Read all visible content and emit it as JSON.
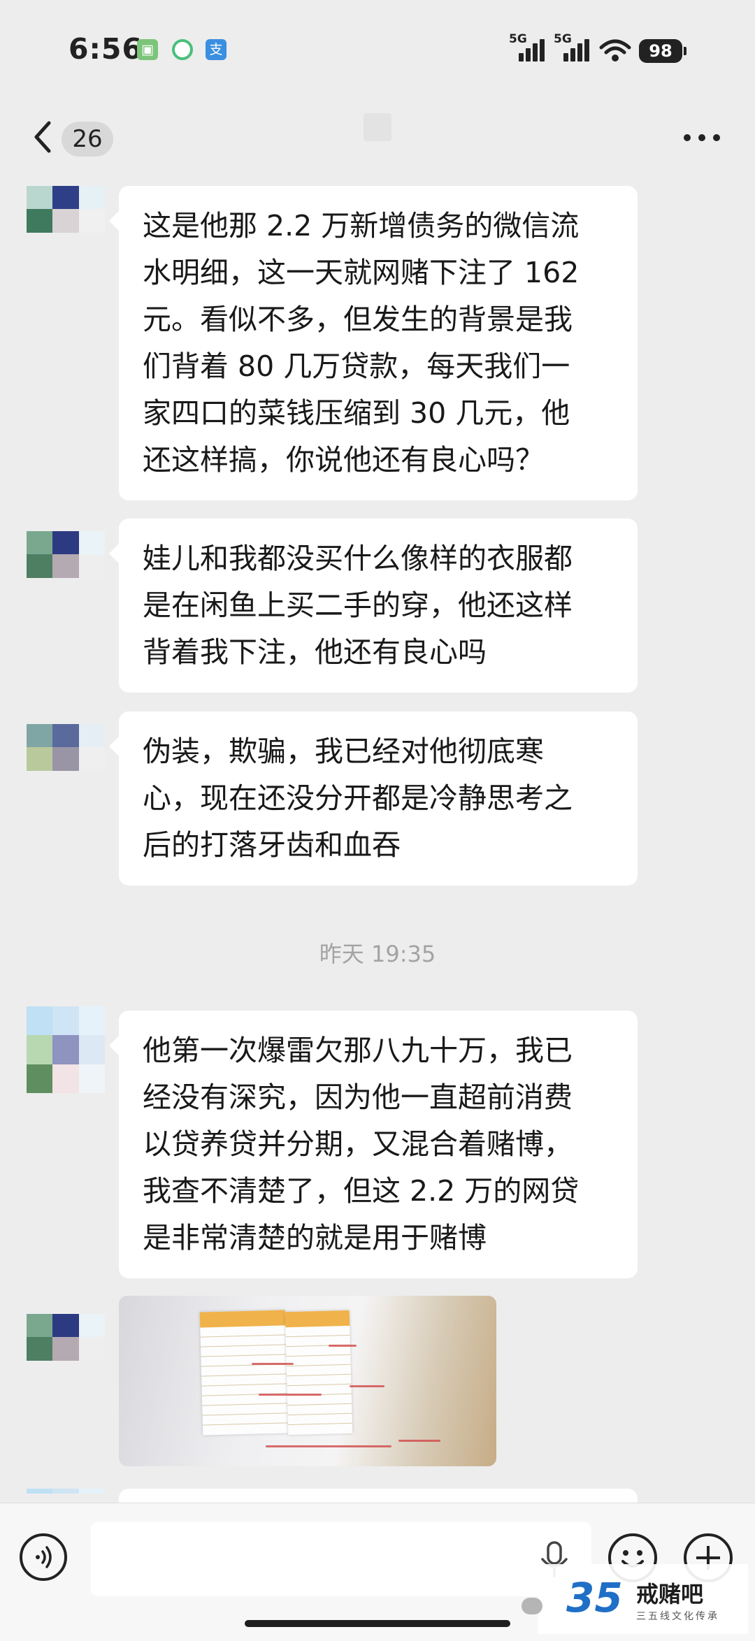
{
  "status_bar": {
    "time": "6:56",
    "signal1_label": "5G",
    "signal2_label": "5G",
    "battery": "98"
  },
  "header": {
    "unread_count": "26"
  },
  "messages": [
    {
      "type": "text",
      "text": "这是他那 2.2 万新增债务的微信流\n水明细，这一天就网赌下注了 162\n元。看似不多，但发生的背景是我\n们背着 80 几万贷款，每天我们一\n家四口的菜钱压缩到 30 几元，他\n还这样搞，你说他还有良心吗？"
    },
    {
      "type": "text",
      "text": "娃儿和我都没买什么像样的衣服都\n是在闲鱼上买二手的穿，他还这样\n背着我下注，他还有良心吗"
    },
    {
      "type": "text",
      "text": "伪装，欺骗，我已经对他彻底寒\n心，现在还没分开都是冷静思考之\n后的打落牙齿和血吞"
    },
    {
      "type": "timestamp",
      "text": "昨天 19:35"
    },
    {
      "type": "text",
      "text": "他第一次爆雷欠那八九十万，我已\n经没有深究，因为他一直超前消费\n以贷养贷并分期，又混合着赌博，\n我查不清楚了，但这 2.2 万的网贷\n是非常清楚的就是用于赌博"
    },
    {
      "type": "image",
      "description": "photo of handwritten debt tables"
    }
  ],
  "input": {
    "placeholder": ""
  },
  "watermark": {
    "number": "35",
    "name": "戒赌吧",
    "sub": "三五线文化传承"
  },
  "colors": {
    "background": "#ededed",
    "bubble": "#ffffff",
    "timestamp": "#a3a3a3"
  }
}
